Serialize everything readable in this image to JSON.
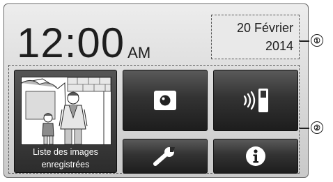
{
  "clock": {
    "time": "12:00",
    "period": "AM"
  },
  "date": {
    "line1": "20 Février",
    "line2": "2014"
  },
  "tiles": {
    "recorded_images_label": "Liste des images enregistrées"
  },
  "callouts": {
    "date_marker": "①",
    "tiles_marker": "②"
  }
}
